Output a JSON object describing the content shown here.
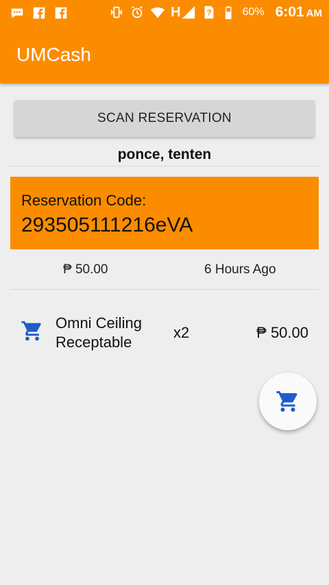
{
  "status_bar": {
    "battery_percent": "60%",
    "time": "6:01",
    "ampm": "AM",
    "network_label": "H",
    "left_icons": [
      "messages-icon",
      "facebook-icon",
      "facebook-icon"
    ],
    "right_icons": [
      "vibrate-icon",
      "alarm-icon",
      "wifi-icon",
      "signal-icon",
      "sim-icon",
      "battery-icon"
    ]
  },
  "app_bar": {
    "title": "UMCash"
  },
  "colors": {
    "primary": "#fb8c00",
    "accent": "#1e5cc8",
    "background": "#eeeeee"
  },
  "scan_button": {
    "label": "SCAN RESERVATION"
  },
  "customer": {
    "name": "ponce, tenten"
  },
  "reservation": {
    "code_label": "Reservation Code:",
    "code": "293505111216eVA",
    "total": "₱ 50.00",
    "time_ago": "6 Hours Ago"
  },
  "items": [
    {
      "name": "Omni Ceiling Receptable",
      "qty": "x2",
      "price": "₱ 50.00",
      "icon": "cart-icon"
    }
  ],
  "fab": {
    "icon": "cart-icon"
  }
}
